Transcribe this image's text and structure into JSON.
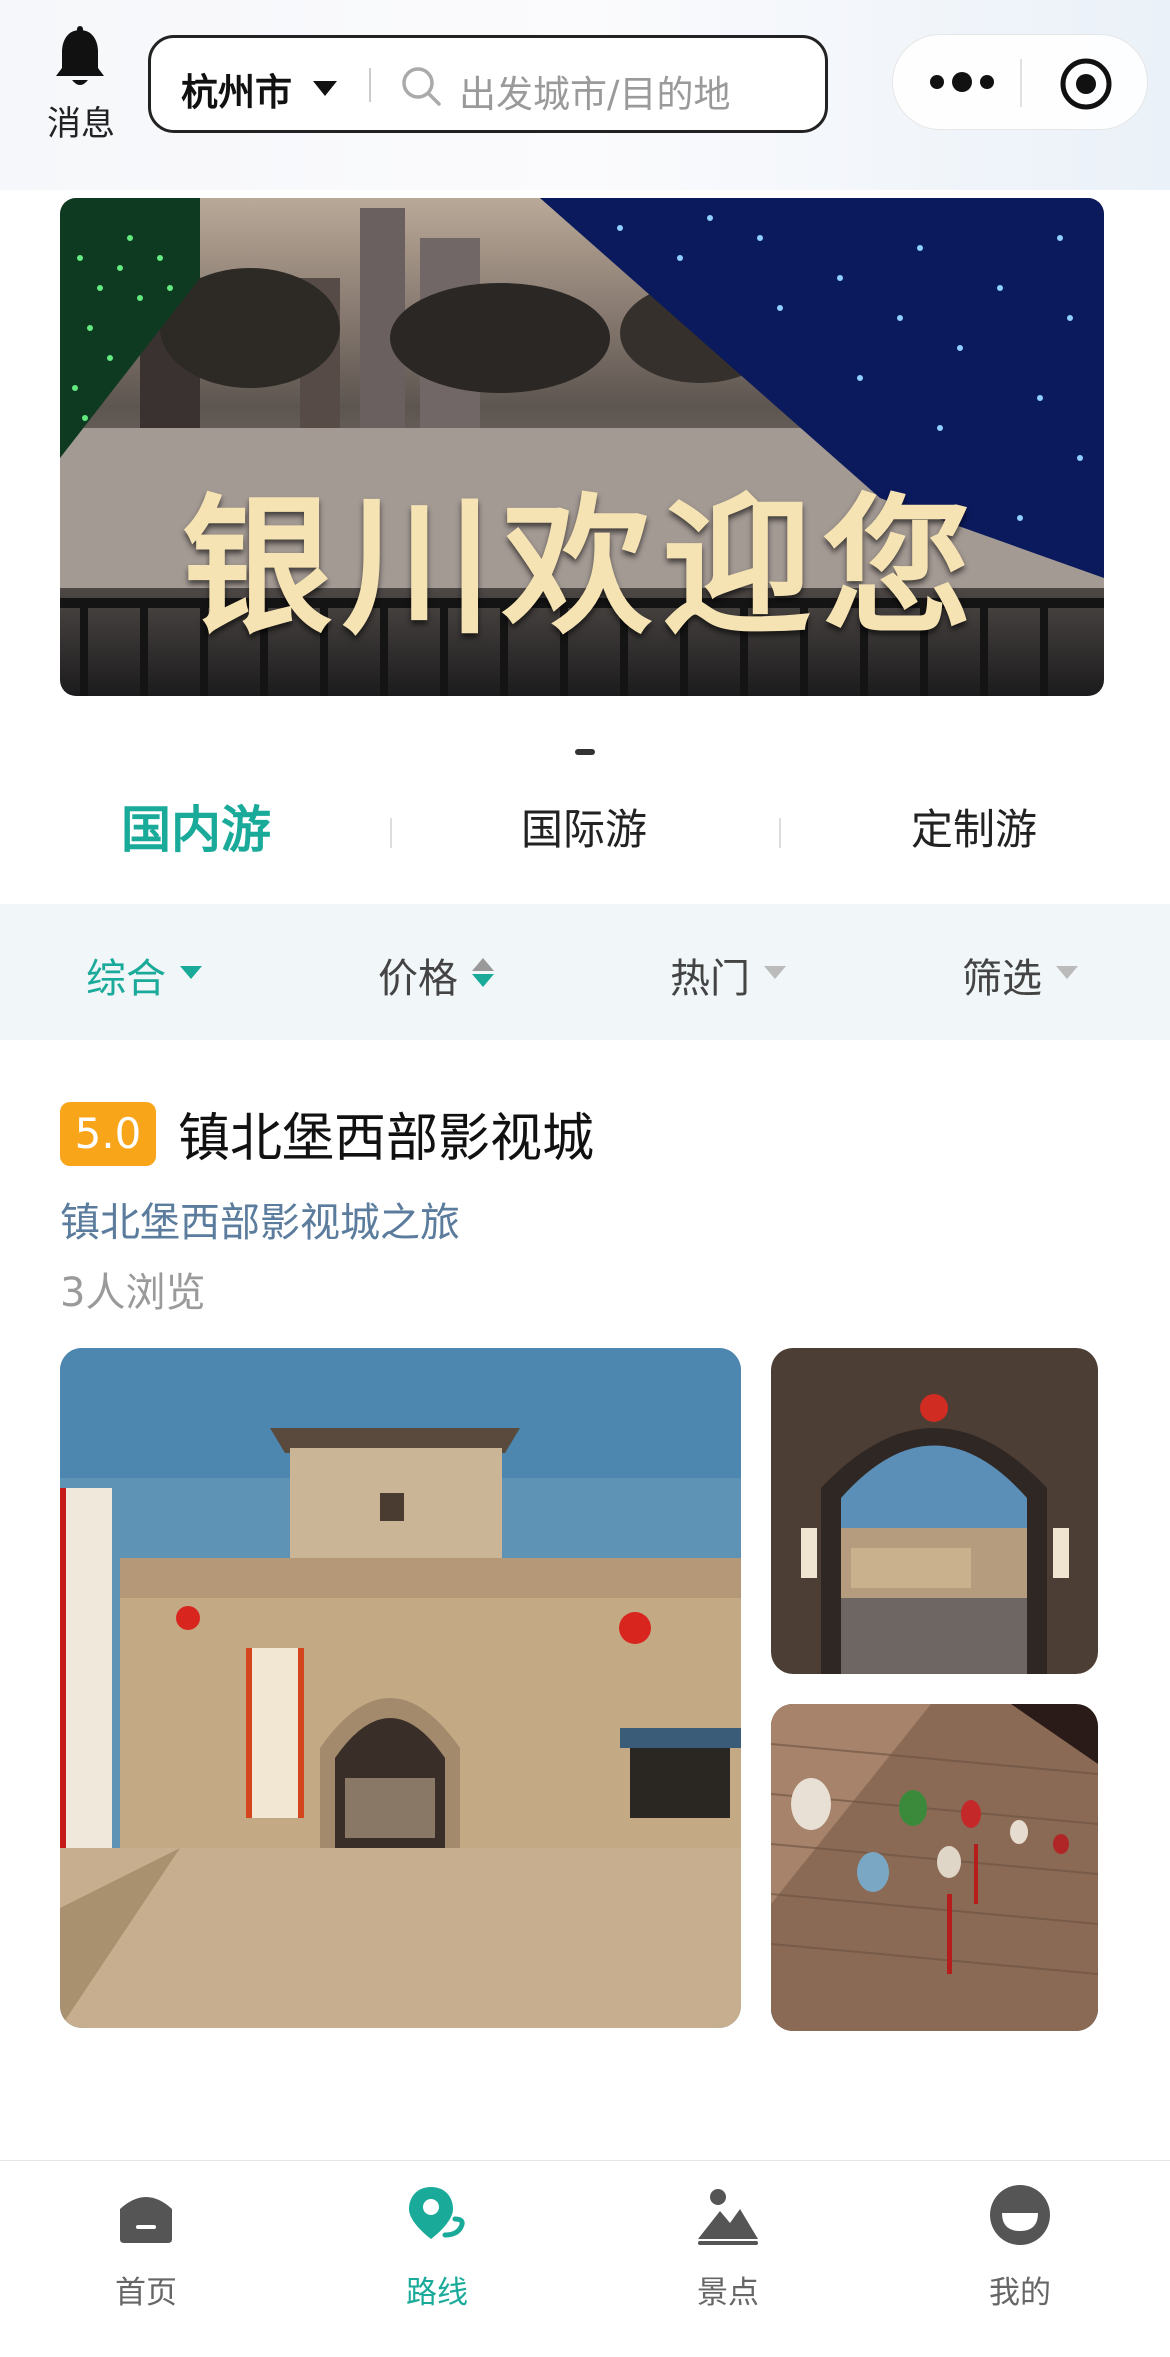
{
  "header": {
    "messages_label": "消息",
    "city": "杭州市",
    "search_placeholder": "出发城市/目的地"
  },
  "banner": {
    "text": "银川欢迎您"
  },
  "category_tabs": [
    {
      "label": "国内游",
      "active": true
    },
    {
      "label": "国际游",
      "active": false
    },
    {
      "label": "定制游",
      "active": false
    }
  ],
  "filters": [
    {
      "label": "综合",
      "active": true
    },
    {
      "label": "价格",
      "active": false
    },
    {
      "label": "热门",
      "active": false
    },
    {
      "label": "筛选",
      "active": false
    }
  ],
  "listing": {
    "rating": "5.0",
    "title": "镇北堡西部影视城",
    "subtitle": "镇北堡西部影视城之旅",
    "views": "3人浏览"
  },
  "bottom_nav": [
    {
      "label": "首页",
      "icon": "home-icon",
      "active": false
    },
    {
      "label": "路线",
      "icon": "route-icon",
      "active": true
    },
    {
      "label": "景点",
      "icon": "scenery-icon",
      "active": false
    },
    {
      "label": "我的",
      "icon": "profile-icon",
      "active": false
    }
  ],
  "colors": {
    "accent": "#1aaa99",
    "rating_badge": "#f9a51a",
    "subtitle": "#5b7c9c",
    "filter_bg": "#f1f6f8"
  }
}
